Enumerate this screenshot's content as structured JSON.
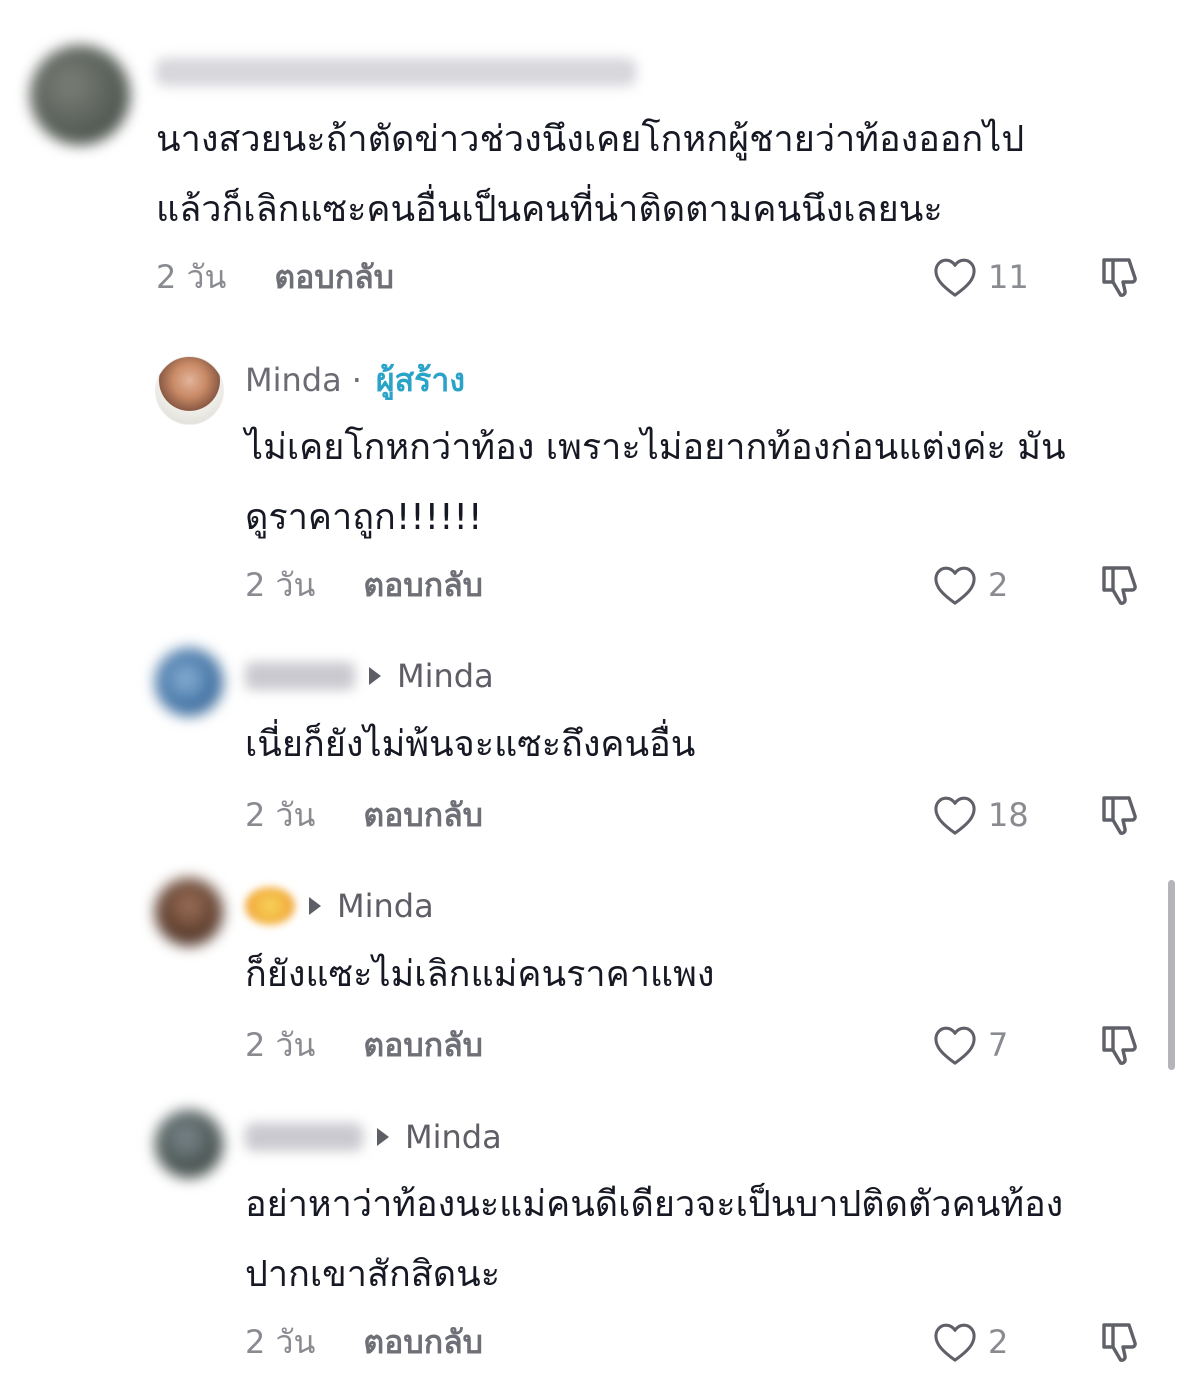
{
  "comments": [
    {
      "id": "c1",
      "username": "นาไร้ลงลูกสาวทันตเล้ยสาคสง",
      "text_lines": [
        "นางสวยนะถ้าตัดข่าวช่วงนึงเคยโกหกผู้ชายว่าท้องออกไป",
        "แล้วก็เลิกแซะคนอื่นเป็นคนที่น่าติดตามคนนึงเลยนะ"
      ],
      "time": "2 วัน",
      "reply_label": "ตอบกลับ",
      "likes": "11"
    },
    {
      "id": "c2",
      "username": "Minda",
      "separator": "·",
      "badge": "ผู้สร้าง",
      "text_lines": [
        "ไม่เคยโกหกว่าท้อง เพราะไม่อยากท้องก่อนแต่งค่ะ มัน",
        "ดูราคาถูก!!!!!!"
      ],
      "time": "2 วัน",
      "reply_label": "ตอบกลับ",
      "likes": "2"
    },
    {
      "id": "c3",
      "username": "Kikchi",
      "reply_to": "Minda",
      "text_lines": [
        "เนี่ยก็ยังไม่พ้นจะแซะถึงคนอื่น"
      ],
      "time": "2 วัน",
      "reply_label": "ตอบกลับ",
      "likes": "18"
    },
    {
      "id": "c4",
      "username": "🙂",
      "reply_to": "Minda",
      "text_lines": [
        "ก็ยังแซะไม่เลิกแม่คนราคาแพง"
      ],
      "time": "2 วัน",
      "reply_label": "ตอบกลับ",
      "likes": "7"
    },
    {
      "id": "c5",
      "username": "khame",
      "reply_to": "Minda",
      "text_lines": [
        "อย่าหาว่าท้องนะแม่คนดีเดียวจะเป็นบาปติดตัวคนท้อง",
        "ปากเขาสักสิดนะ"
      ],
      "time": "2 วัน",
      "reply_label": "ตอบกลับ",
      "likes": "2"
    }
  ],
  "icons": {
    "like": "heart-outline-icon",
    "dislike": "thumbs-down-outline-icon",
    "reply_arrow": "play-triangle-icon"
  },
  "colors": {
    "creator_badge": "#2aa3c8",
    "muted": "#8a8b91",
    "text": "#161823"
  }
}
